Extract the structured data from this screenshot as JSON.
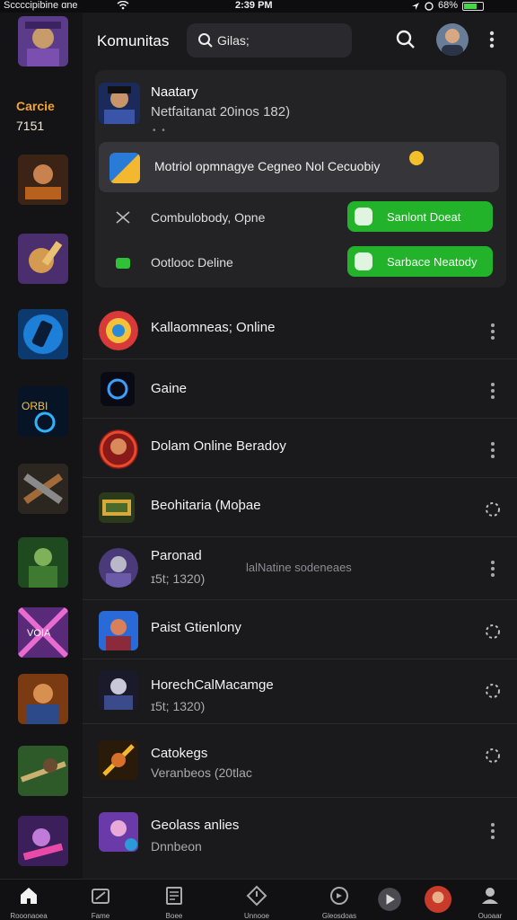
{
  "status_bar": {
    "carrier": "Sccccipibine ɑne",
    "time": "2:39 PM",
    "battery": "68%",
    "battery_level": 0.68
  },
  "left_rail": {
    "promo_line1": "Carcie",
    "promo_line2": "7151"
  },
  "header": {
    "title": "Komunitas",
    "search_query": "Gilas;"
  },
  "notification_panel": {
    "title": "Naatary",
    "subtitle": "Netfaitanat 20inos 182)",
    "notice_text": "Motriol opmnagye Cegneo Nol Cecuobiy",
    "row1": {
      "label": "Combulobody, Opne",
      "button_label": "Sanlont Doeat"
    },
    "row2": {
      "label": "Ootlooc Deline",
      "button_label": "Sarbace Neatody"
    }
  },
  "list": [
    {
      "title": "Kallaomneas; Online",
      "subtitle": "",
      "subtitle2": ""
    },
    {
      "title": "Gaine",
      "subtitle": "",
      "subtitle2": ""
    },
    {
      "title": "Dolam Online Beradoy",
      "subtitle": "",
      "subtitle2": ""
    },
    {
      "title": "Beohitaria  (Moþae",
      "subtitle": "",
      "subtitle2": ""
    },
    {
      "title": "Paronad",
      "subtitle": "ɪ5t; 1320)",
      "subtitle2": "lalNatine sodeneaes"
    },
    {
      "title": "Paist Gtienlony",
      "subtitle": "",
      "subtitle2": ""
    },
    {
      "title": "HorechCalMacamge",
      "subtitle": "ɪ5t; 1320)",
      "subtitle2": ""
    },
    {
      "title": "Catokegs",
      "subtitle": "Veranbeos (20tlac",
      "subtitle2": ""
    },
    {
      "title": "Geolass anlies",
      "subtitle": "Dnnbeon",
      "subtitle2": ""
    }
  ],
  "bottom_nav": [
    {
      "label": "Rooonaoea",
      "icon": "home-icon"
    },
    {
      "label": "Fame",
      "icon": "game-icon"
    },
    {
      "label": "Boee",
      "icon": "news-icon"
    },
    {
      "label": "Unnooe",
      "icon": "diamond-icon"
    },
    {
      "label": "Gleosdoas",
      "icon": "reload-icon"
    },
    {
      "label": "",
      "icon": "play-icon"
    },
    {
      "label": "",
      "icon": "avatar"
    },
    {
      "label": "Ouoaar",
      "icon": "profile-icon"
    }
  ],
  "colors": {
    "background": "#1a1a1d",
    "panel": "#232326",
    "notice": "#36363a",
    "accent_green": "#22b32b",
    "promo_orange": "#f3a52e"
  }
}
